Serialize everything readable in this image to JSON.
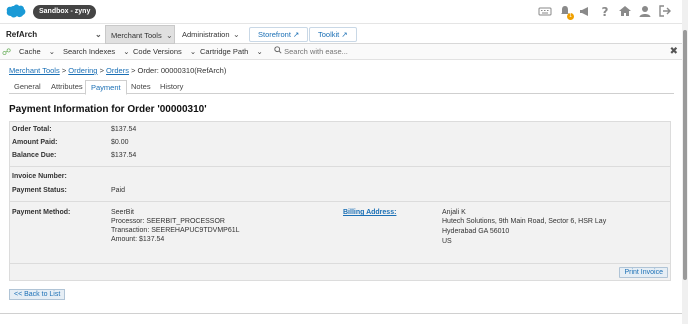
{
  "header": {
    "sandbox_label": "Sandbox - zyny",
    "icons": [
      "keyboard-icon",
      "bell-icon",
      "megaphone-icon",
      "help-icon",
      "home-icon",
      "user-icon",
      "logout-icon"
    ],
    "notification_count": "1"
  },
  "nav": {
    "site": "RefArch",
    "tabs": [
      {
        "label": "Merchant Tools",
        "active": true
      },
      {
        "label": "Administration",
        "active": false
      }
    ],
    "links": [
      {
        "label": "Storefront"
      },
      {
        "label": "Toolkit"
      }
    ]
  },
  "toolbar": {
    "items": [
      "Cache",
      "Search Indexes",
      "Code Versions",
      "Cartridge Path"
    ],
    "search_placeholder": "Search with ease..."
  },
  "breadcrumb": {
    "items": [
      "Merchant Tools",
      "Ordering",
      "Orders"
    ],
    "current": "Order: 00000310(RefArch)"
  },
  "subtabs": [
    {
      "label": "General",
      "active": false
    },
    {
      "label": "Attributes",
      "active": false
    },
    {
      "label": "Payment",
      "active": true
    },
    {
      "label": "Notes",
      "active": false
    },
    {
      "label": "History",
      "active": false
    }
  ],
  "page_title": "Payment Information for Order '00000310'",
  "totals": {
    "order_total_label": "Order Total:",
    "order_total": "$137.54",
    "amount_paid_label": "Amount Paid:",
    "amount_paid": "$0.00",
    "balance_due_label": "Balance Due:",
    "balance_due": "$137.54"
  },
  "invoice": {
    "invoice_number_label": "Invoice Number:",
    "invoice_number": "",
    "payment_status_label": "Payment Status:",
    "payment_status": "Paid"
  },
  "payment": {
    "method_label": "Payment Method:",
    "method_lines": [
      "SeerBit",
      "Processor: SEERBIT_PROCESSOR",
      "Transaction: SEEREHAPUC9TDVMP61L",
      "Amount: $137.54"
    ],
    "billing_label": "Billing Address:",
    "billing_lines": [
      "Anjali K",
      "Hutech Solutions, 9th Main Road, Sector 6, HSR Lay",
      "Hyderabad GA 56010",
      "US"
    ]
  },
  "actions": {
    "print_invoice": "Print Invoice",
    "back_to_list": "<< Back to List"
  },
  "colors": {
    "link": "#1a6fb5",
    "panel_bg": "#f2f2f2",
    "active_tab_bg": "#e0e0e0"
  }
}
